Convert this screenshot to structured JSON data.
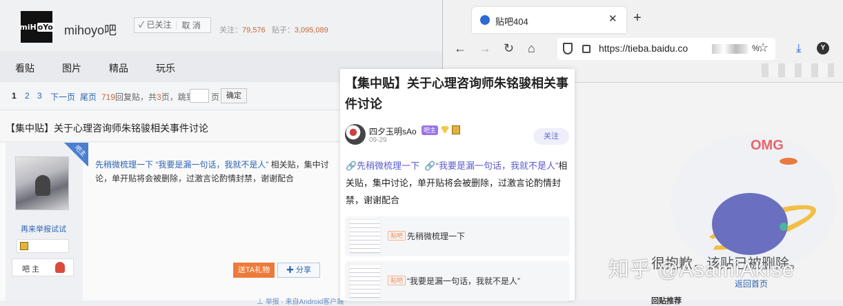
{
  "forum": {
    "logo_text": "miH",
    "logo_accent": "oYo",
    "name": "mihoyo吧",
    "followed_label": "✓ 已关注",
    "cancel_label": "取 消",
    "followers_label": "关注：",
    "followers": "79,576",
    "posts_label": "贴子：",
    "posts": "3,095,089"
  },
  "nav": {
    "items": [
      "看贴",
      "图片",
      "精品",
      "玩乐"
    ]
  },
  "pager": {
    "pages": [
      "1",
      "2",
      "3"
    ],
    "next": "下一页",
    "last": "尾页",
    "replies": "719",
    "replies_suffix": "回复贴，共",
    "total_pages": "3",
    "jump_suffix": "页，跳到",
    "page_unit": "页",
    "confirm": "确定"
  },
  "thread": {
    "title": "【集中贴】关于心理咨询师朱铭骏相关事件讨论",
    "corner_label": "吧主",
    "author_link": "再来举报试试",
    "role": "吧 主",
    "link_text": "先稍微梳理一下 “我要是漏一句话，我就不是人”",
    "body_text": " 相关贴，集中讨论，单开贴将会被删除，过激言论酌情封禁，谢谢配合",
    "gift": "送TA礼物",
    "share": "✚ 分享",
    "bottom_link": "⊥ 举报  · 来自Android客户端"
  },
  "browser": {
    "tab_title": "贴吧404",
    "tab_close": "✕",
    "new_tab": "+",
    "url": "https://tieba.baidu.co",
    "url_tail": "%"
  },
  "card": {
    "title": "【集中贴】关于心理咨询师朱铭骏相关事件讨论",
    "user": "四夕玉明sAo",
    "user_tag": "吧主",
    "date": "09-29",
    "follow": "关注",
    "link1": "🔗先稍微梳理一下",
    "link2": "🔗“我要是漏一句话，我就不是人”",
    "body": "相关贴，集中讨论，单开贴将会被删除，过激言论酌情封禁，谢谢配合",
    "items": [
      {
        "tag": "贴吧",
        "title": "先稍微梳理一下"
      },
      {
        "tag": "贴吧",
        "title": "“我要是漏一句话，我就不是人”"
      }
    ]
  },
  "error_page": {
    "omg": "OMG",
    "message": "很抱歉，该贴已被删除。",
    "back_home": "返回首页",
    "related": "回贴推荐"
  },
  "watermark": "知乎 @AsamiAkise"
}
